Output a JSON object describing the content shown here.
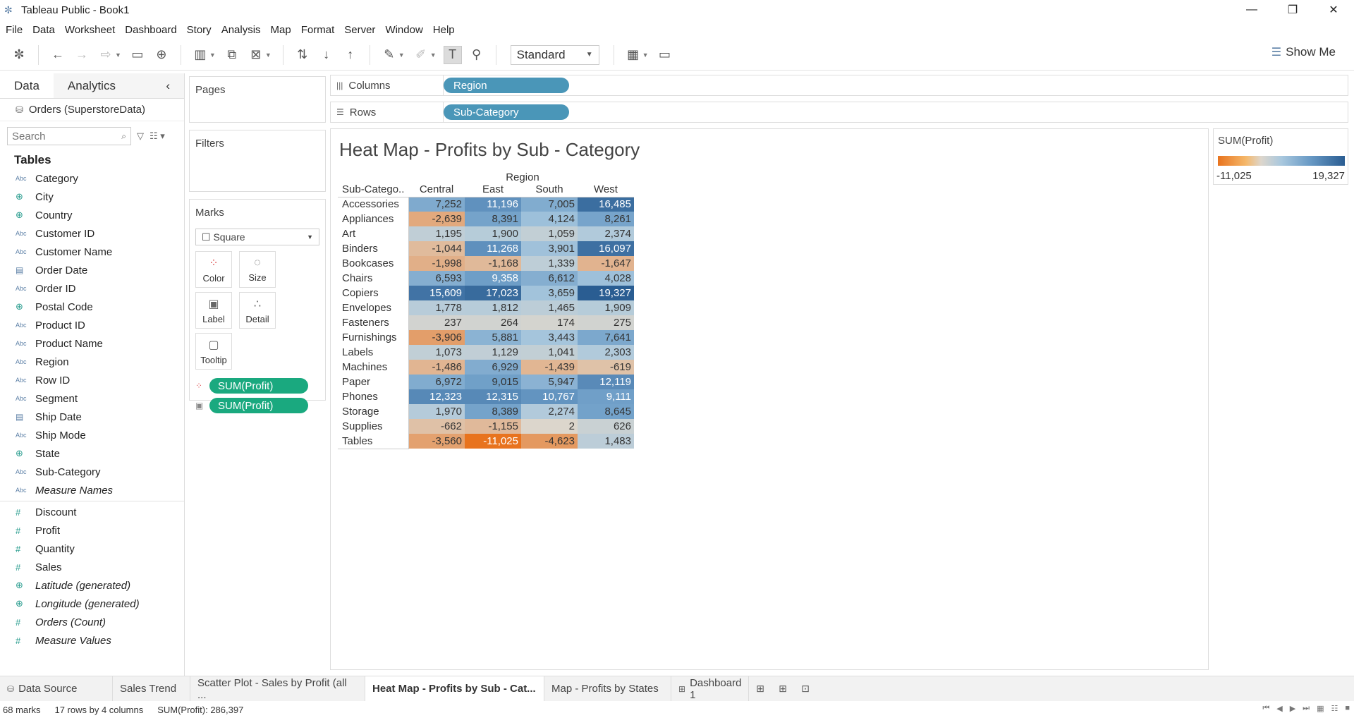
{
  "window": {
    "title": "Tableau Public - Book1"
  },
  "menu": [
    "File",
    "Data",
    "Worksheet",
    "Dashboard",
    "Story",
    "Analysis",
    "Map",
    "Format",
    "Server",
    "Window",
    "Help"
  ],
  "toolbar": {
    "fit_select": "Standard",
    "show_me": "Show Me"
  },
  "data_pane": {
    "tab_data": "Data",
    "tab_analytics": "Analytics",
    "datasource": "Orders (SuperstoreData)",
    "search_placeholder": "Search",
    "tables_heading": "Tables",
    "dimensions": [
      {
        "name": "Category",
        "type": "abc"
      },
      {
        "name": "City",
        "type": "geo"
      },
      {
        "name": "Country",
        "type": "geo"
      },
      {
        "name": "Customer ID",
        "type": "abc"
      },
      {
        "name": "Customer Name",
        "type": "abc"
      },
      {
        "name": "Order Date",
        "type": "date"
      },
      {
        "name": "Order ID",
        "type": "abc"
      },
      {
        "name": "Postal Code",
        "type": "geo"
      },
      {
        "name": "Product ID",
        "type": "abc"
      },
      {
        "name": "Product Name",
        "type": "abc"
      },
      {
        "name": "Region",
        "type": "abc"
      },
      {
        "name": "Row ID",
        "type": "abc"
      },
      {
        "name": "Segment",
        "type": "abc"
      },
      {
        "name": "Ship Date",
        "type": "date"
      },
      {
        "name": "Ship Mode",
        "type": "abc"
      },
      {
        "name": "State",
        "type": "geo"
      },
      {
        "name": "Sub-Category",
        "type": "abc"
      },
      {
        "name": "Measure Names",
        "type": "abc",
        "italic": true
      }
    ],
    "measures": [
      {
        "name": "Discount",
        "type": "meas"
      },
      {
        "name": "Profit",
        "type": "meas"
      },
      {
        "name": "Quantity",
        "type": "meas"
      },
      {
        "name": "Sales",
        "type": "meas"
      },
      {
        "name": "Latitude (generated)",
        "type": "geo",
        "italic": true
      },
      {
        "name": "Longitude (generated)",
        "type": "geo",
        "italic": true
      },
      {
        "name": "Orders (Count)",
        "type": "meas",
        "italic": true
      },
      {
        "name": "Measure Values",
        "type": "meas",
        "italic": true
      }
    ]
  },
  "shelves": {
    "pages": "Pages",
    "filters": "Filters",
    "marks": "Marks",
    "mark_type": "Square",
    "mark_buttons": [
      "Color",
      "Size",
      "Label",
      "Detail",
      "Tooltip"
    ],
    "mark_pills": [
      "SUM(Profit)",
      "SUM(Profit)"
    ],
    "columns_label": "Columns",
    "columns_pill": "Region",
    "rows_label": "Rows",
    "rows_pill": "Sub-Category"
  },
  "viz": {
    "title": "Heat Map - Profits by Sub - Category",
    "column_header": "Region",
    "row_header": "Sub-Catego..",
    "columns": [
      "Central",
      "East",
      "South",
      "West"
    ],
    "rows": [
      {
        "label": "Accessories",
        "values": [
          7252,
          11196,
          7005,
          16485
        ]
      },
      {
        "label": "Appliances",
        "values": [
          -2639,
          8391,
          4124,
          8261
        ]
      },
      {
        "label": "Art",
        "values": [
          1195,
          1900,
          1059,
          2374
        ]
      },
      {
        "label": "Binders",
        "values": [
          -1044,
          11268,
          3901,
          16097
        ]
      },
      {
        "label": "Bookcases",
        "values": [
          -1998,
          -1168,
          1339,
          -1647
        ]
      },
      {
        "label": "Chairs",
        "values": [
          6593,
          9358,
          6612,
          4028
        ]
      },
      {
        "label": "Copiers",
        "values": [
          15609,
          17023,
          3659,
          19327
        ]
      },
      {
        "label": "Envelopes",
        "values": [
          1778,
          1812,
          1465,
          1909
        ]
      },
      {
        "label": "Fasteners",
        "values": [
          237,
          264,
          174,
          275
        ]
      },
      {
        "label": "Furnishings",
        "values": [
          -3906,
          5881,
          3443,
          7641
        ]
      },
      {
        "label": "Labels",
        "values": [
          1073,
          1129,
          1041,
          2303
        ]
      },
      {
        "label": "Machines",
        "values": [
          -1486,
          6929,
          -1439,
          -619
        ]
      },
      {
        "label": "Paper",
        "values": [
          6972,
          9015,
          5947,
          12119
        ]
      },
      {
        "label": "Phones",
        "values": [
          12323,
          12315,
          10767,
          9111
        ]
      },
      {
        "label": "Storage",
        "values": [
          1970,
          8389,
          2274,
          8645
        ]
      },
      {
        "label": "Supplies",
        "values": [
          -662,
          -1155,
          2,
          626
        ]
      },
      {
        "label": "Tables",
        "values": [
          -3560,
          -11025,
          -4623,
          1483
        ]
      }
    ]
  },
  "legend": {
    "title": "SUM(Profit)",
    "min_label": "-11,025",
    "max_label": "19,327",
    "min": -11025,
    "max": 19327
  },
  "sheet_tabs": {
    "data_source": "Data Source",
    "tabs": [
      {
        "label": "Sales Trend",
        "active": false
      },
      {
        "label": "Scatter Plot - Sales by Profit (all ...",
        "active": false
      },
      {
        "label": "Heat Map - Profits by Sub - Cat...",
        "active": true
      },
      {
        "label": "Map - Profits by States",
        "active": false
      },
      {
        "label": "Dashboard 1",
        "active": false,
        "dashboard": true
      }
    ]
  },
  "status": {
    "marks": "68 marks",
    "dims": "17 rows by 4 columns",
    "sum": "SUM(Profit): 286,397"
  }
}
